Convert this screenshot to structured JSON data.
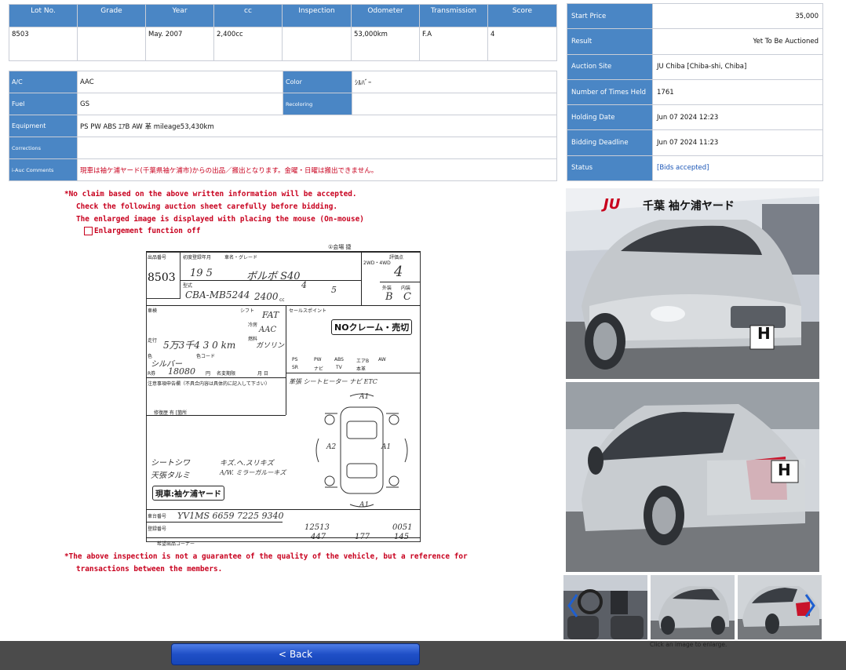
{
  "lot": {
    "headers": [
      "Lot No.",
      "Grade",
      "Year",
      "cc",
      "Inspection",
      "Odometer",
      "Transmission",
      "Score"
    ],
    "values": [
      "8503",
      "",
      "May. 2007",
      "2,400cc",
      "",
      "53,000km",
      "F.A",
      "4"
    ]
  },
  "details": {
    "ac_label": "A/C",
    "ac_value": "AAC",
    "color_label": "Color",
    "color_value": "ｼﾙﾊﾞｰ",
    "fuel_label": "Fuel",
    "fuel_value": "GS",
    "recoloring_label": "Recoloring",
    "recoloring_value": "",
    "equipment_label": "Equipment",
    "equipment_value": "PS PW ABS ｴｱB AW 革  mileage53,430km",
    "corrections_label": "Corrections",
    "corrections_value": "",
    "comments_label": "i-Auc Comments",
    "comments_value": "現車は袖ケ浦ヤード(千葉県袖ケ浦市)からの出品／搬出となります。金曜・日曜は搬出できません。"
  },
  "info": {
    "start_price_label": "Start Price",
    "start_price_value": "35,000",
    "result_label": "Result",
    "result_value": "Yet To Be Auctioned",
    "site_label": "Auction Site",
    "site_value": "JU Chiba [Chiba-shi, Chiba]",
    "times_label": "Number of Times Held",
    "times_value": "1761",
    "holding_label": "Holding Date",
    "holding_value": "Jun 07 2024 12:23",
    "deadline_label": "Bidding Deadline",
    "deadline_value": "Jun 07 2024 11:23",
    "status_label": "Status",
    "status_value": "[Bids accepted]"
  },
  "notices": {
    "line1": "*No claim based on the above written information will be accepted.",
    "line2": "Check the following auction sheet carefully before bidding.",
    "line3": "The enlarged image is displayed with placing the mouse (On-mouse)",
    "toggle": "Enlargement function off",
    "footer1": "*The above inspection is not a guarantee of the quality of the vehicle, but a reference for",
    "footer2": "transactions between the members."
  },
  "sheet": {
    "lot_number": "8503",
    "model_code": "CBA-MB5244",
    "displacement": "2400",
    "year_hw": "19  5",
    "car_name_hw": "ボルボ  S40",
    "odometer_hw": "5万3千4 3 0 km",
    "score_hw": "4",
    "interior_hw": "B",
    "exterior_hw": "C",
    "color_hw": "シルバー",
    "price_hw": "18080",
    "stamp_noclaim": "NOクレーム・売切",
    "stamp_yard": "現車:袖ケ浦ヤード",
    "chassis_hw": "YV1MS 6659 7225 9340",
    "notes_hw1": "シートシワ",
    "notes_hw2": "天張タルミ",
    "notes_hw3": "キズ.ヘ.スリキズ",
    "notes_hw4": "A/W. ミラーガルーキズ",
    "selling_points_hw": "革張 シートヒーター ナビ ETC",
    "fuel_hw": "ガソリン",
    "ac_hw": "AAC",
    "header_text": "①会場  捷",
    "lbl_lot": "出品番号",
    "lbl_year": "初度登録年月",
    "lbl_name": "車名・グレード",
    "lbl_type": "型式",
    "lbl_score": "評価点",
    "lbl_exterior": "外装",
    "lbl_interior": "内装",
    "lbl_4wd": "2WD・4WD",
    "lbl_inspect": "車検",
    "lbl_mileage": "走行",
    "lbl_color": "色",
    "lbl_colorcode": "色コード",
    "lbl_points": "セールスポイント",
    "lbl_caution": "注意事項申告欄（不具合内容は具体的に記入して下さい）",
    "lbl_repair": "修復歴  有 [箇所",
    "lbl_chassis": "車台番号",
    "lbl_reg": "登録番号",
    "lbl_hope": "希望出品コーナー",
    "lbl_cc": "cc",
    "lbl_shift": "シフト",
    "lbl_aircon": "冷房",
    "lbl_fuel": "燃料",
    "lbl_price": "R券",
    "lbl_yen": "円",
    "lbl_owner": "名変期限",
    "lbl_day": "月  日",
    "equip_ps": "PS",
    "equip_pw": "PW",
    "equip_abs": "ABS",
    "equip_airb": "エアB",
    "equip_aw": "AW",
    "equip_sr": "SR",
    "equip_navi": "ナビ",
    "equip_tv": "TV",
    "equip_leather": "本革",
    "tbl_num1": "12513",
    "tbl_num2": "0051",
    "tbl_num3": "447",
    "tbl_num4": "177",
    "tbl_num5": "145",
    "diag_a1": "A1",
    "diag_a2": "A2",
    "diag_a1b": "A1",
    "diag_a1c": "A1",
    "hw_transmission": "FAT",
    "hw_doors": "4",
    "hw_capacity": "5",
    "hw_fuel_small": "ガソリン"
  },
  "photos": {
    "main_sign_ju": "JU",
    "main_sign_text": "千葉 袖ケ浦ヤード",
    "main_plate": "H",
    "second_plate": "H"
  },
  "thumbs": {
    "caption": "Click an image to enlarge."
  },
  "back": {
    "label": "Back",
    "icon": "chevron-left-icon"
  },
  "colors": {
    "header_blue": "#4a86c5",
    "notice_red": "#c8001e",
    "link_blue": "#1a55b6",
    "bar_gray": "#4b4b4b",
    "button_blue": "#1f4fc7"
  }
}
